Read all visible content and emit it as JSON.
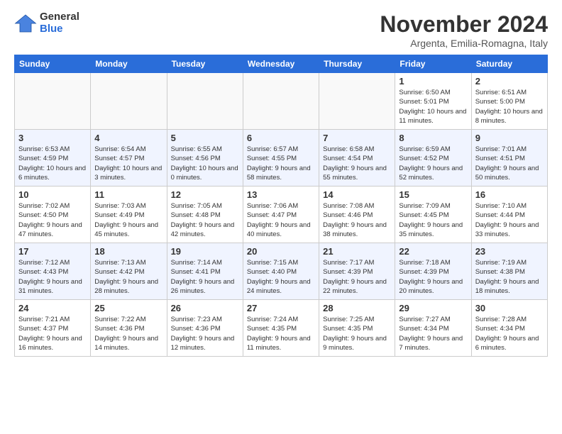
{
  "logo": {
    "general": "General",
    "blue": "Blue"
  },
  "header": {
    "month": "November 2024",
    "location": "Argenta, Emilia-Romagna, Italy"
  },
  "weekdays": [
    "Sunday",
    "Monday",
    "Tuesday",
    "Wednesday",
    "Thursday",
    "Friday",
    "Saturday"
  ],
  "weeks": [
    [
      {
        "day": "",
        "info": ""
      },
      {
        "day": "",
        "info": ""
      },
      {
        "day": "",
        "info": ""
      },
      {
        "day": "",
        "info": ""
      },
      {
        "day": "",
        "info": ""
      },
      {
        "day": "1",
        "info": "Sunrise: 6:50 AM\nSunset: 5:01 PM\nDaylight: 10 hours and 11 minutes."
      },
      {
        "day": "2",
        "info": "Sunrise: 6:51 AM\nSunset: 5:00 PM\nDaylight: 10 hours and 8 minutes."
      }
    ],
    [
      {
        "day": "3",
        "info": "Sunrise: 6:53 AM\nSunset: 4:59 PM\nDaylight: 10 hours and 6 minutes."
      },
      {
        "day": "4",
        "info": "Sunrise: 6:54 AM\nSunset: 4:57 PM\nDaylight: 10 hours and 3 minutes."
      },
      {
        "day": "5",
        "info": "Sunrise: 6:55 AM\nSunset: 4:56 PM\nDaylight: 10 hours and 0 minutes."
      },
      {
        "day": "6",
        "info": "Sunrise: 6:57 AM\nSunset: 4:55 PM\nDaylight: 9 hours and 58 minutes."
      },
      {
        "day": "7",
        "info": "Sunrise: 6:58 AM\nSunset: 4:54 PM\nDaylight: 9 hours and 55 minutes."
      },
      {
        "day": "8",
        "info": "Sunrise: 6:59 AM\nSunset: 4:52 PM\nDaylight: 9 hours and 52 minutes."
      },
      {
        "day": "9",
        "info": "Sunrise: 7:01 AM\nSunset: 4:51 PM\nDaylight: 9 hours and 50 minutes."
      }
    ],
    [
      {
        "day": "10",
        "info": "Sunrise: 7:02 AM\nSunset: 4:50 PM\nDaylight: 9 hours and 47 minutes."
      },
      {
        "day": "11",
        "info": "Sunrise: 7:03 AM\nSunset: 4:49 PM\nDaylight: 9 hours and 45 minutes."
      },
      {
        "day": "12",
        "info": "Sunrise: 7:05 AM\nSunset: 4:48 PM\nDaylight: 9 hours and 42 minutes."
      },
      {
        "day": "13",
        "info": "Sunrise: 7:06 AM\nSunset: 4:47 PM\nDaylight: 9 hours and 40 minutes."
      },
      {
        "day": "14",
        "info": "Sunrise: 7:08 AM\nSunset: 4:46 PM\nDaylight: 9 hours and 38 minutes."
      },
      {
        "day": "15",
        "info": "Sunrise: 7:09 AM\nSunset: 4:45 PM\nDaylight: 9 hours and 35 minutes."
      },
      {
        "day": "16",
        "info": "Sunrise: 7:10 AM\nSunset: 4:44 PM\nDaylight: 9 hours and 33 minutes."
      }
    ],
    [
      {
        "day": "17",
        "info": "Sunrise: 7:12 AM\nSunset: 4:43 PM\nDaylight: 9 hours and 31 minutes."
      },
      {
        "day": "18",
        "info": "Sunrise: 7:13 AM\nSunset: 4:42 PM\nDaylight: 9 hours and 28 minutes."
      },
      {
        "day": "19",
        "info": "Sunrise: 7:14 AM\nSunset: 4:41 PM\nDaylight: 9 hours and 26 minutes."
      },
      {
        "day": "20",
        "info": "Sunrise: 7:15 AM\nSunset: 4:40 PM\nDaylight: 9 hours and 24 minutes."
      },
      {
        "day": "21",
        "info": "Sunrise: 7:17 AM\nSunset: 4:39 PM\nDaylight: 9 hours and 22 minutes."
      },
      {
        "day": "22",
        "info": "Sunrise: 7:18 AM\nSunset: 4:39 PM\nDaylight: 9 hours and 20 minutes."
      },
      {
        "day": "23",
        "info": "Sunrise: 7:19 AM\nSunset: 4:38 PM\nDaylight: 9 hours and 18 minutes."
      }
    ],
    [
      {
        "day": "24",
        "info": "Sunrise: 7:21 AM\nSunset: 4:37 PM\nDaylight: 9 hours and 16 minutes."
      },
      {
        "day": "25",
        "info": "Sunrise: 7:22 AM\nSunset: 4:36 PM\nDaylight: 9 hours and 14 minutes."
      },
      {
        "day": "26",
        "info": "Sunrise: 7:23 AM\nSunset: 4:36 PM\nDaylight: 9 hours and 12 minutes."
      },
      {
        "day": "27",
        "info": "Sunrise: 7:24 AM\nSunset: 4:35 PM\nDaylight: 9 hours and 11 minutes."
      },
      {
        "day": "28",
        "info": "Sunrise: 7:25 AM\nSunset: 4:35 PM\nDaylight: 9 hours and 9 minutes."
      },
      {
        "day": "29",
        "info": "Sunrise: 7:27 AM\nSunset: 4:34 PM\nDaylight: 9 hours and 7 minutes."
      },
      {
        "day": "30",
        "info": "Sunrise: 7:28 AM\nSunset: 4:34 PM\nDaylight: 9 hours and 6 minutes."
      }
    ]
  ]
}
